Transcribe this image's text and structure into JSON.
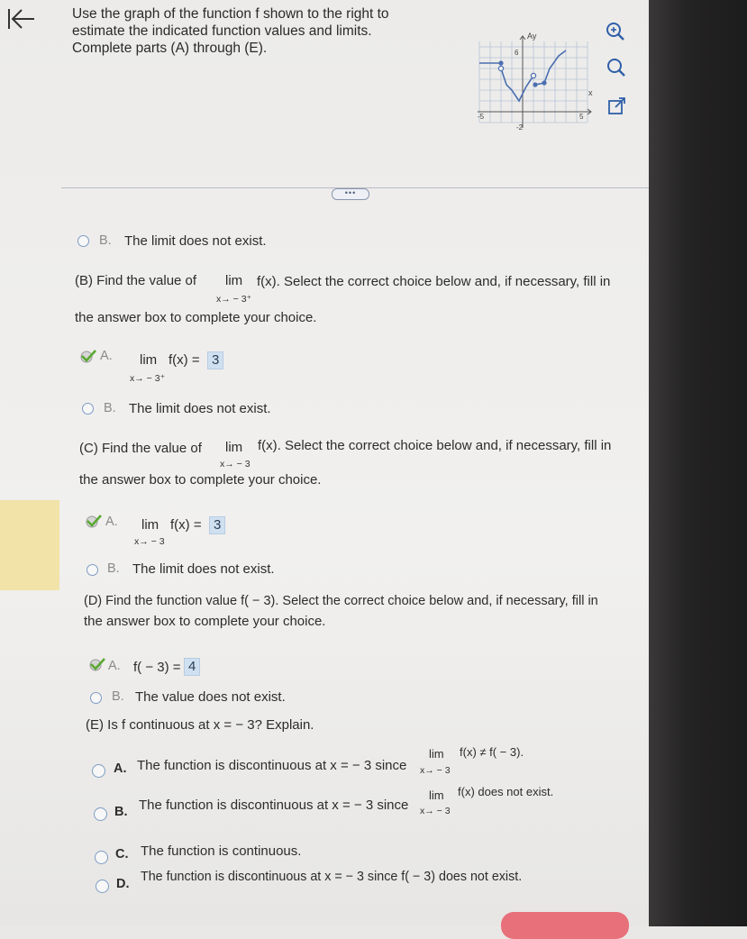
{
  "prompt": {
    "line1": "Use the graph of the function f shown to the right to",
    "line2": "estimate the indicated function values and limits.",
    "line3": "Complete parts (A) through (E)."
  },
  "graph": {
    "y_axis_label": "Ay",
    "x_axis_label": "x",
    "tick_top": "6",
    "tick_left": "-5",
    "tick_right": "5",
    "tick_bottom": "-2"
  },
  "toolbar": {
    "zoom_in": "zoom-in-icon",
    "zoom": "magnifier-icon",
    "popout": "popout-icon"
  },
  "more_button": "•••",
  "partA_rest": {
    "choiceB_letter": "B.",
    "choiceB_text": "The limit does not exist."
  },
  "partB": {
    "q_pre": "(B) Find the value of",
    "lim": "lim",
    "fx": "f(x). Select the correct choice below and, if necessary, fill in",
    "sub": "x→ − 3⁺",
    "q_line2": "the answer box to complete your choice.",
    "choiceA_letter": "A.",
    "choiceA_lim": "lim",
    "choiceA_fx": "f(x) =",
    "choiceA_sub": "x→ − 3⁺",
    "choiceA_value": "3",
    "choiceB_letter": "B.",
    "choiceB_text": "The limit does not exist."
  },
  "partC": {
    "q_pre": "(C) Find the value of",
    "lim": "lim",
    "fx": "f(x). Select the correct choice below and, if necessary, fill in",
    "sub": "x→ − 3",
    "q_line2": "the answer box to complete your choice.",
    "choiceA_letter": "A.",
    "choiceA_lim": "lim",
    "choiceA_fx": "f(x) =",
    "choiceA_sub": "x→ − 3",
    "choiceA_value": "3",
    "choiceB_letter": "B.",
    "choiceB_text": "The limit does not exist."
  },
  "partD": {
    "q_line1": "(D) Find the function value f( − 3). Select the correct choice below and, if necessary, fill in",
    "q_line2": "the answer box to complete your choice.",
    "choiceA_letter": "A.",
    "choiceA_fx": "f( − 3) =",
    "choiceA_value": "4",
    "choiceB_letter": "B.",
    "choiceB_text": "The value does not exist."
  },
  "partE": {
    "q": "(E) Is f continuous at x =  − 3? Explain.",
    "choiceA_letter": "A.",
    "choiceA_text": "The function is discontinuous at x =  − 3 since",
    "choiceA_lim": "lim",
    "choiceA_tail": "f(x) ≠ f( − 3).",
    "choiceA_sub": "x→ − 3",
    "choiceB_letter": "B.",
    "choiceB_text": "The function is discontinuous at x =  − 3 since",
    "choiceB_lim": "lim",
    "choiceB_tail": "f(x) does not exist.",
    "choiceB_sub": "x→ − 3",
    "choiceC_letter": "C.",
    "choiceC_text": "The function is continuous.",
    "choiceD_letter": "D.",
    "choiceD_text": "The function is discontinuous at x =  − 3 since f( − 3) does not exist."
  },
  "colors": {
    "accent_blue": "#7d9cc4",
    "answer_box": "#cfe0f1",
    "check_green": "#5aa832",
    "submit": "#e8707a"
  }
}
